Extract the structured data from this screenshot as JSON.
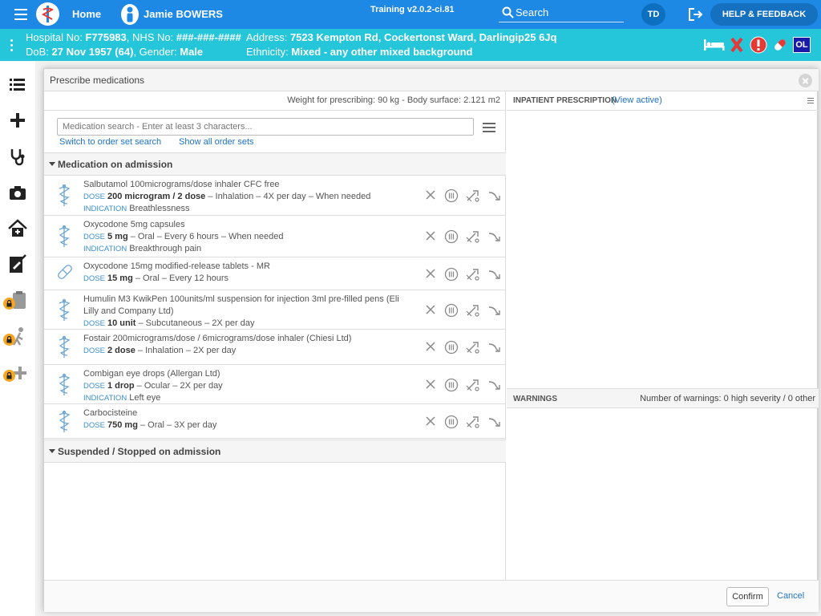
{
  "topbar": {
    "home_label": "Home",
    "patient_name": "Jamie BOWERS",
    "version": "Training v2.0.2-ci.81",
    "search_label": "Search",
    "user_initials": "TD",
    "help_label": "HELP & FEEDBACK"
  },
  "banner": {
    "hospital_label": "Hospital No:",
    "hospital_no": "F775983",
    "nhs_label": ", NHS No:",
    "nhs_no": "###-###-####",
    "address_label": "Address:",
    "address": "7523 Kempton Rd, Cockertonst Ward, Darlingip25 6Jq",
    "dob_label": "DoB:",
    "dob": "27 Nov 1957 (64)",
    "gender_label": ", Gender:",
    "gender": "Male",
    "ethnicity_label": "Ethnicity:",
    "ethnicity": "Mixed - any other mixed background",
    "ol_badge": "OL"
  },
  "modal": {
    "title": "Prescribe medications",
    "weight_text": "Weight for prescribing: 90 kg - Body surface: 2.121 m2",
    "search_placeholder": "Medication search - Enter at least 3 characters...",
    "switch_link": "Switch to order set search",
    "show_all_link": "Show all order sets",
    "section_admission": "Medication on admission",
    "section_suspended": "Suspended / Stopped on admission",
    "dose_label": "DOSE",
    "indication_label": "INDICATION",
    "medications": [
      {
        "name": "Salbutamol 100micrograms/dose inhaler CFC free",
        "dose": "200 microgram / 2 dose",
        "route": " – Inhalation – 4X per day – When needed",
        "indication": "Breathlessness",
        "icon": "inhaler-icon"
      },
      {
        "name": "Oxycodone 5mg capsules",
        "dose": "5 mg",
        "route": " – Oral – Every 6 hours – When needed",
        "indication": "Breakthrough pain",
        "icon": "inhaler-icon"
      },
      {
        "name": "Oxycodone 15mg modified-release tablets - MR",
        "dose": "15 mg",
        "route": " – Oral – Every 12 hours",
        "indication": "",
        "icon": "capsule-icon"
      },
      {
        "name": "Humulin M3 KwikPen 100units/ml suspension for injection 3ml pre-filled pens (Eli Lilly and Company Ltd)",
        "dose": "10 unit",
        "route": " – Subcutaneous – 2X per day",
        "indication": "",
        "icon": "inhaler-icon"
      },
      {
        "name": "Fostair 200micrograms/dose / 6micrograms/dose inhaler (Chiesi Ltd)",
        "dose": "2 dose",
        "route": " – Inhalation – 2X per day",
        "indication": "",
        "icon": "inhaler-icon"
      },
      {
        "name": "Combigan eye drops (Allergan Ltd)",
        "dose": "1 drop",
        "route": " – Ocular – 2X per day",
        "indication": "Left eye",
        "icon": "inhaler-icon"
      },
      {
        "name": "Carbocisteine",
        "dose": "750 mg",
        "route": " – Oral – 3X per day",
        "indication": "",
        "icon": "inhaler-icon"
      }
    ],
    "inpatient_title": "INPATIENT PRESCRIPTION",
    "view_active": "(View active)",
    "warnings_title": "WARNINGS",
    "warnings_count": "Number of warnings: 0 high severity / 0 other",
    "confirm_label": "Confirm",
    "cancel_label": "Cancel"
  },
  "colors": {
    "topbar": "#1e88e5",
    "banner": "#26c6da",
    "link": "#1e72c8",
    "alert_red": "#e53935"
  }
}
